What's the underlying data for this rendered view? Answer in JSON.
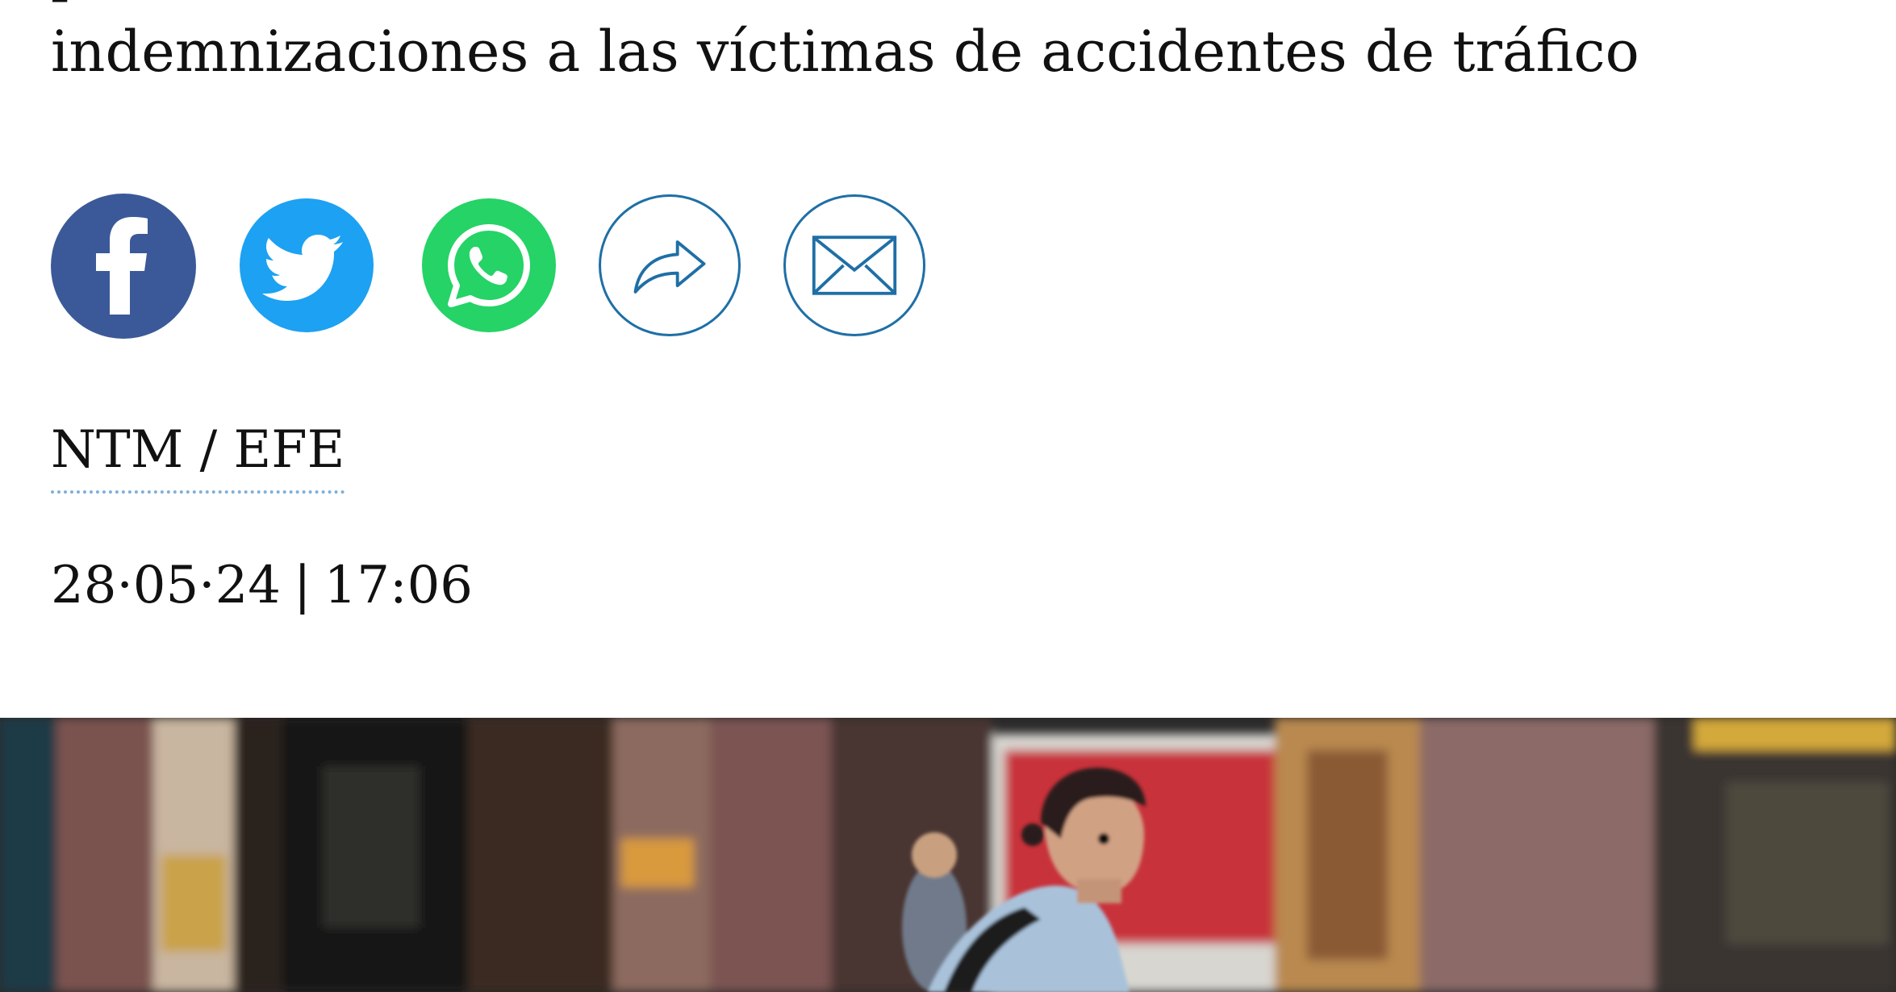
{
  "article": {
    "headline_line1": "p                                                              ",
    "headline_line2": "indemnizaciones a las víctimas de accidentes de tráfico",
    "byline": "NTM / EFE",
    "date": "28·05·24",
    "separator": "|",
    "time": "17:06"
  },
  "share": {
    "buttons": [
      {
        "id": "facebook",
        "icon": "facebook-icon",
        "color": "#3b5998"
      },
      {
        "id": "twitter",
        "icon": "twitter-bird-icon",
        "color": "#1da1f2"
      },
      {
        "id": "whatsapp",
        "icon": "whatsapp-icon",
        "color": "#25d366"
      },
      {
        "id": "share",
        "icon": "share-arrow-icon",
        "color": "#1f6fa6"
      },
      {
        "id": "email",
        "icon": "envelope-icon",
        "color": "#1f6fa6"
      }
    ]
  },
  "photo": {
    "subject": "man-walking-with-backpack"
  }
}
